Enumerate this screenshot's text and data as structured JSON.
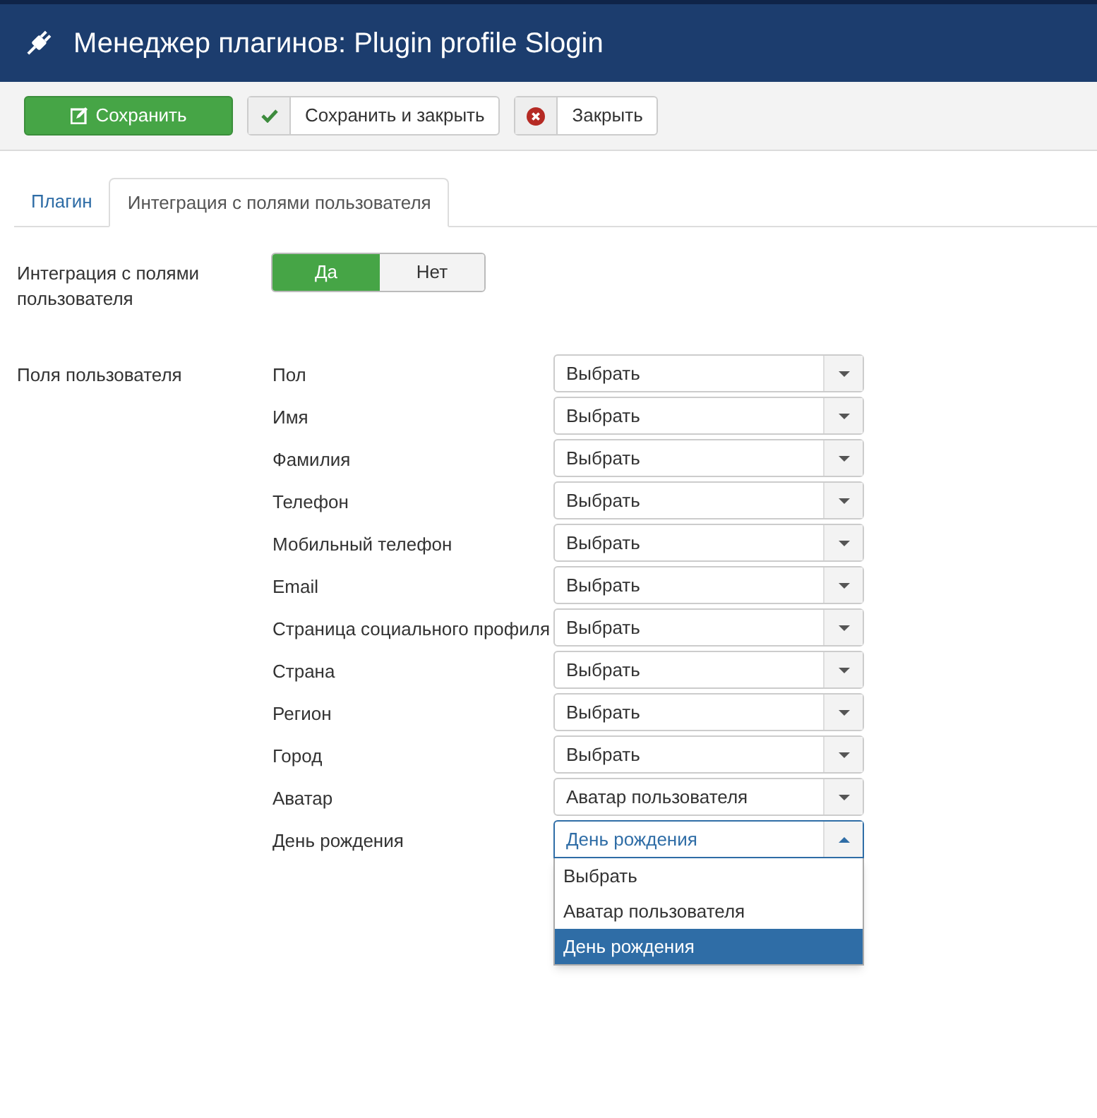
{
  "header": {
    "title": "Менеджер плагинов: Plugin profile Slogin"
  },
  "toolbar": [
    {
      "kind": "save",
      "label": "Сохранить"
    },
    {
      "kind": "save-close",
      "label": "Сохранить и закрыть"
    },
    {
      "kind": "close",
      "label": "Закрыть"
    }
  ],
  "tabs": [
    {
      "label": "Плагин",
      "selected": false
    },
    {
      "label": "Интеграция с полями пользователя",
      "selected": true
    }
  ],
  "integration": {
    "label": "Интеграция с полями пользователя",
    "options": [
      {
        "label": "Да",
        "selected": true
      },
      {
        "label": "Нет",
        "selected": false
      }
    ]
  },
  "user_fields": {
    "label": "Поля пользователя",
    "fields": [
      {
        "label": "Пол",
        "value": "Выбрать",
        "expanded": false
      },
      {
        "label": "Имя",
        "value": "Выбрать",
        "expanded": false
      },
      {
        "label": "Фамилия",
        "value": "Выбрать",
        "expanded": false
      },
      {
        "label": "Телефон",
        "value": "Выбрать",
        "expanded": false
      },
      {
        "label": "Мобильный телефон",
        "value": "Выбрать",
        "expanded": false
      },
      {
        "label": "Email",
        "value": "Выбрать",
        "expanded": false
      },
      {
        "label": "Страница социального профиля",
        "value": "Выбрать",
        "expanded": false
      },
      {
        "label": "Страна",
        "value": "Выбрать",
        "expanded": false
      },
      {
        "label": "Регион",
        "value": "Выбрать",
        "expanded": false
      },
      {
        "label": "Город",
        "value": "Выбрать",
        "expanded": false
      },
      {
        "label": "Аватар",
        "value": "Аватар пользователя",
        "expanded": false
      },
      {
        "label": "День рождения",
        "value": "День рождения",
        "expanded": true,
        "options": [
          {
            "label": "Выбрать",
            "selected": false
          },
          {
            "label": "Аватар пользователя",
            "selected": false
          },
          {
            "label": "День рождения",
            "selected": true
          }
        ]
      }
    ]
  }
}
